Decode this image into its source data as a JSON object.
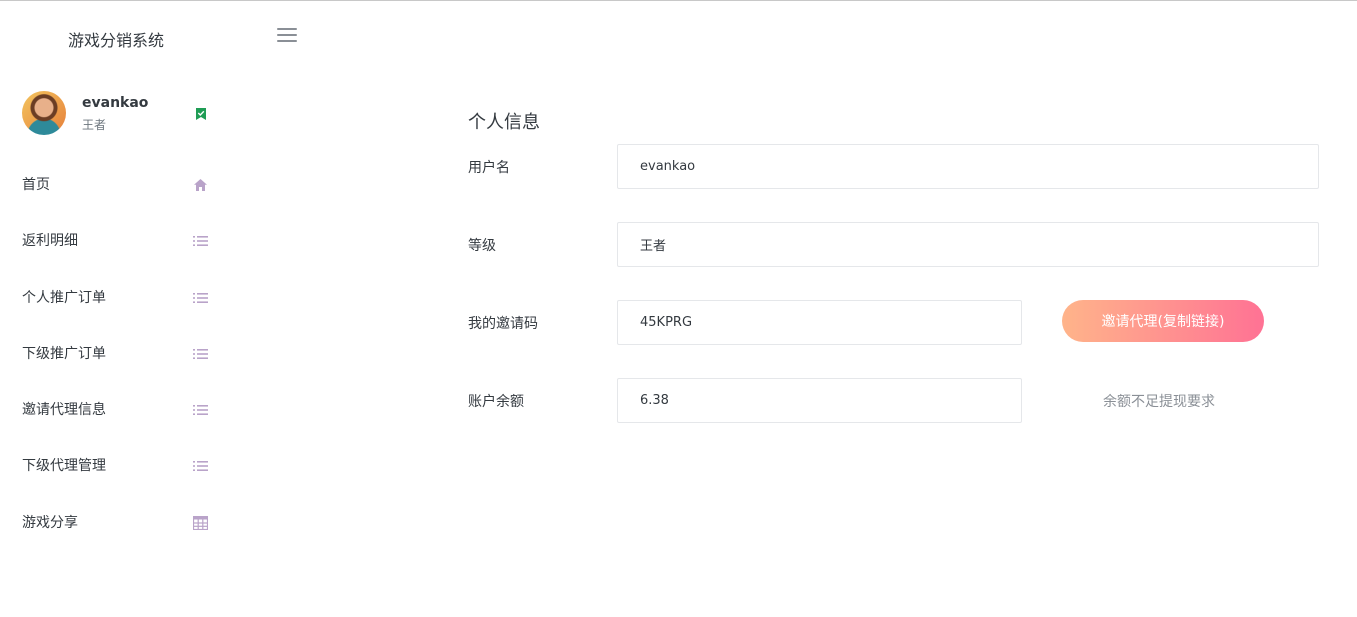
{
  "app": {
    "title": "游戏分销系统"
  },
  "profile": {
    "username": "evankao",
    "level": "王者"
  },
  "nav": [
    {
      "label": "首页",
      "icon": "home-icon"
    },
    {
      "label": "返利明细",
      "icon": "list-icon"
    },
    {
      "label": "个人推广订单",
      "icon": "list-icon"
    },
    {
      "label": "下级推广订单",
      "icon": "list-icon"
    },
    {
      "label": "邀请代理信息",
      "icon": "list-icon"
    },
    {
      "label": "下级代理管理",
      "icon": "list-icon"
    },
    {
      "label": "游戏分享",
      "icon": "grid-icon"
    }
  ],
  "colors": {
    "accent_start": "#ffb48a",
    "accent_end": "#ff7294",
    "icon": "#b9a3c9",
    "verified": "#1f9d55"
  },
  "main": {
    "section_title": "个人信息",
    "fields": {
      "username": {
        "label": "用户名",
        "value": "evankao"
      },
      "level": {
        "label": "等级",
        "value": "王者"
      },
      "invite_code": {
        "label": "我的邀请码",
        "value": "45KPRG"
      },
      "balance": {
        "label": "账户余额",
        "value": "6.38"
      }
    },
    "invite_button": "邀请代理(复制链接)",
    "balance_hint": "余额不足提现要求"
  }
}
